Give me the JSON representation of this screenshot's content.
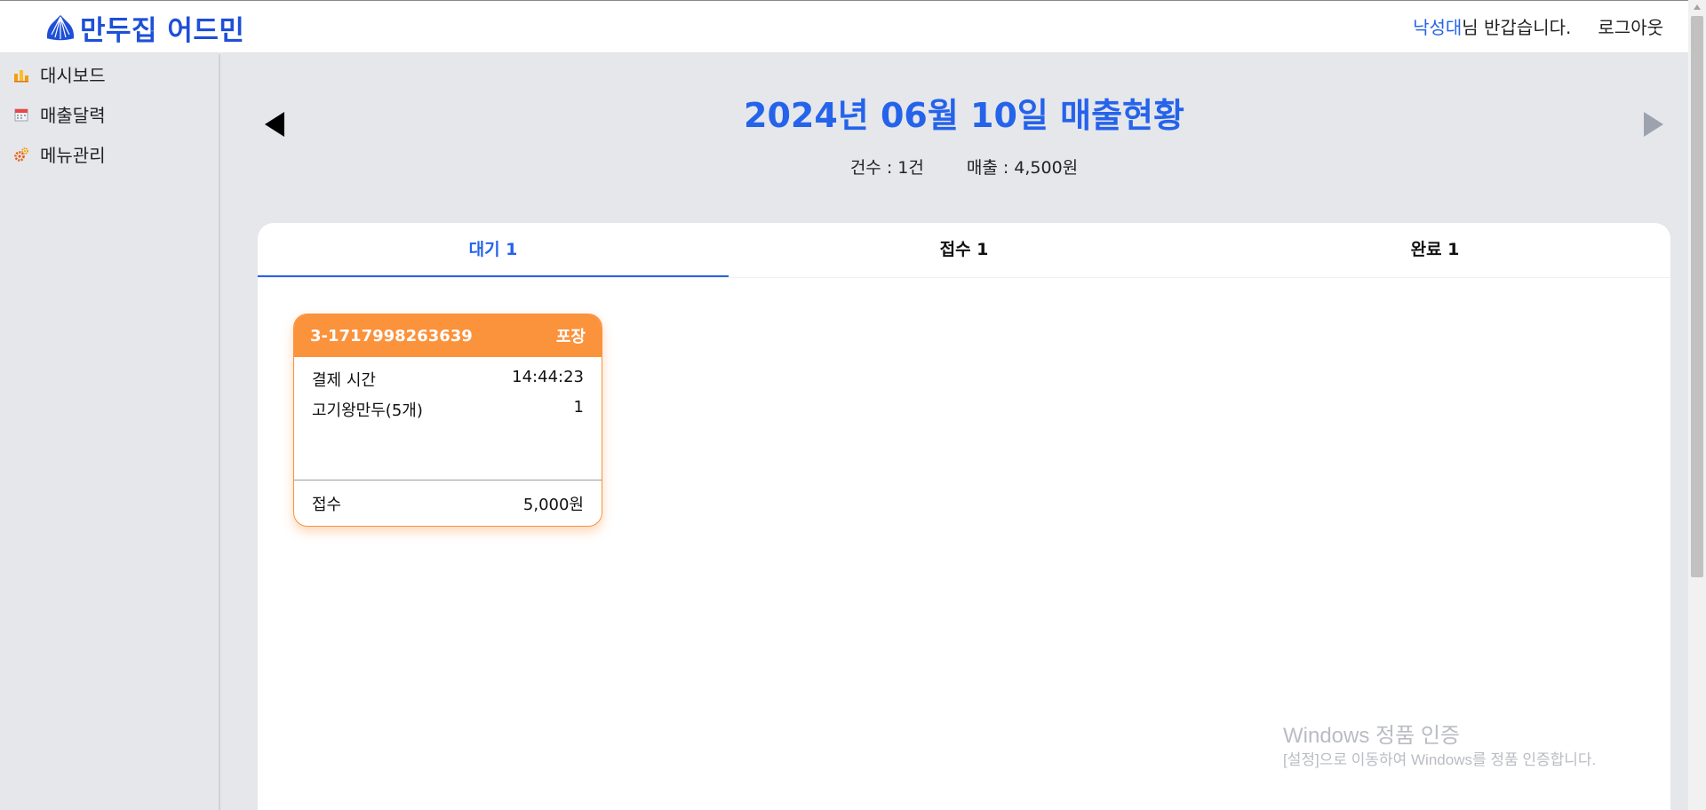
{
  "header": {
    "logo_text": "만두집 어드민",
    "user_name": "낙성대",
    "greeting": "님 반갑습니다.",
    "logout_label": "로그아웃"
  },
  "sidebar": {
    "items": [
      {
        "label": "대시보드",
        "icon": "dashboard-chart-icon"
      },
      {
        "label": "매출달력",
        "icon": "calendar-icon"
      },
      {
        "label": "메뉴관리",
        "icon": "gear-icon"
      }
    ]
  },
  "main": {
    "title": "2024년 06월 10일 매출현황",
    "stats": {
      "count": "건수 : 1건",
      "sales": "매출 : 4,500원"
    },
    "tabs": [
      {
        "label": "대기 1",
        "active": true
      },
      {
        "label": "접수 1",
        "active": false
      },
      {
        "label": "완료 1",
        "active": false
      }
    ]
  },
  "order_card": {
    "order_id": "3-1717998263639",
    "order_type": "포장",
    "payment_label": "결제 시간",
    "payment_time": "14:44:23",
    "item_name": "고기왕만두(5개)",
    "item_qty": "1",
    "action_label": "접수",
    "total": "5,000원"
  },
  "watermark": {
    "line1": "Windows 정품 인증",
    "line2": "[설정]으로 이동하여 Windows를 정품 인증합니다."
  },
  "colors": {
    "accent": "#2563eb",
    "brand": "#1e4fd8",
    "card_orange": "#fb923c",
    "background": "#e5e7eb"
  }
}
